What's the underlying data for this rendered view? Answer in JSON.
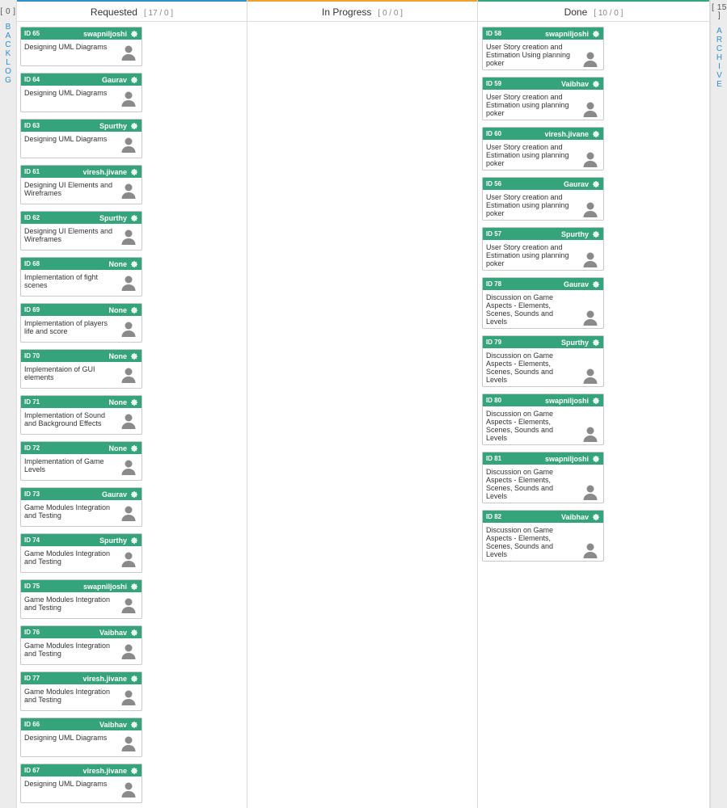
{
  "backlog": {
    "count": "[ 0 ]",
    "label": [
      "B",
      "A",
      "C",
      "K",
      "L",
      "O",
      "G"
    ]
  },
  "archive": {
    "count": "[ 15 ]",
    "label": [
      "A",
      "R",
      "C",
      "H",
      "I",
      "V",
      "E"
    ]
  },
  "columns": [
    {
      "title": "Requested",
      "count": "[ 17 / 0 ]",
      "accent": "#2f8fc9",
      "cards": [
        {
          "id": "ID 65",
          "owner": "swapniljoshi",
          "text": "Designing UML Diagrams"
        },
        {
          "id": "ID 64",
          "owner": "Gaurav",
          "text": "Designing UML Diagrams"
        },
        {
          "id": "ID 63",
          "owner": "Spurthy",
          "text": "Designing UML Diagrams"
        },
        {
          "id": "ID 61",
          "owner": "viresh.jivane",
          "text": "Designing UI Elements and Wireframes"
        },
        {
          "id": "ID 62",
          "owner": "Spurthy",
          "text": "Designing UI Elements and Wireframes"
        },
        {
          "id": "ID 68",
          "owner": "None",
          "text": "Implementation of fight scenes"
        },
        {
          "id": "ID 69",
          "owner": "None",
          "text": "Implementation of players life and score"
        },
        {
          "id": "ID 70",
          "owner": "None",
          "text": "Implementaion of GUI elements"
        },
        {
          "id": "ID 71",
          "owner": "None",
          "text": "Implementation of Sound and Background Effects"
        },
        {
          "id": "ID 72",
          "owner": "None",
          "text": "Implementation of Game Levels"
        },
        {
          "id": "ID 73",
          "owner": "Gaurav",
          "text": "Game Modules Integration and Testing"
        },
        {
          "id": "ID 74",
          "owner": "Spurthy",
          "text": "Game Modules Integration and Testing"
        },
        {
          "id": "ID 75",
          "owner": "swapniljoshi",
          "text": "Game Modules Integration and Testing"
        },
        {
          "id": "ID 76",
          "owner": "Vaibhav",
          "text": "Game Modules Integration and Testing"
        },
        {
          "id": "ID 77",
          "owner": "viresh.jivane",
          "text": "Game Modules Integration and Testing"
        },
        {
          "id": "ID 66",
          "owner": "Vaibhav",
          "text": "Designing UML Diagrams"
        },
        {
          "id": "ID 67",
          "owner": "viresh.jivane",
          "text": "Designing UML Diagrams"
        }
      ]
    },
    {
      "title": "In Progress",
      "count": "[ 0 / 0 ]",
      "accent": "#f0a030",
      "cards": []
    },
    {
      "title": "Done",
      "count": "[ 10 / 0 ]",
      "accent": "#35a37b",
      "cards": [
        {
          "id": "ID 58",
          "owner": "swapniljoshi",
          "text": "User Story creation and Estimation Using planning poker"
        },
        {
          "id": "ID 59",
          "owner": "Vaibhav",
          "text": "User Story creation and Estimation using planning poker"
        },
        {
          "id": "ID 60",
          "owner": "viresh.jivane",
          "text": "User Story creation and Estimation using planning poker"
        },
        {
          "id": "ID 56",
          "owner": "Gaurav",
          "text": "User Story creation and Estimation using planning poker"
        },
        {
          "id": "ID 57",
          "owner": "Spurthy",
          "text": "User Story creation and Estimation using planning poker"
        },
        {
          "id": "ID 78",
          "owner": "Gaurav",
          "text": "Discussion on Game Aspects - Elements, Scenes, Sounds and Levels"
        },
        {
          "id": "ID 79",
          "owner": "Spurthy",
          "text": "Discussion on Game Aspects - Elements, Scenes, Sounds and Levels"
        },
        {
          "id": "ID 80",
          "owner": "swapniljoshi",
          "text": "Discussion on Game Aspects - Elements, Scenes, Sounds and Levels"
        },
        {
          "id": "ID 81",
          "owner": "swapniljoshi",
          "text": "Discussion on Game Aspects - Elements, Scenes, Sounds and Levels"
        },
        {
          "id": "ID 82",
          "owner": "Vaibhav",
          "text": "Discussion on Game Aspects - Elements, Scenes, Sounds and Levels"
        }
      ]
    }
  ],
  "colors": {
    "card_header": "#35a37b",
    "link": "#2f8fc9",
    "avatar": "#888888"
  },
  "icons": {
    "card_settings": "gear-icon",
    "card_owner": "user-avatar-icon"
  }
}
